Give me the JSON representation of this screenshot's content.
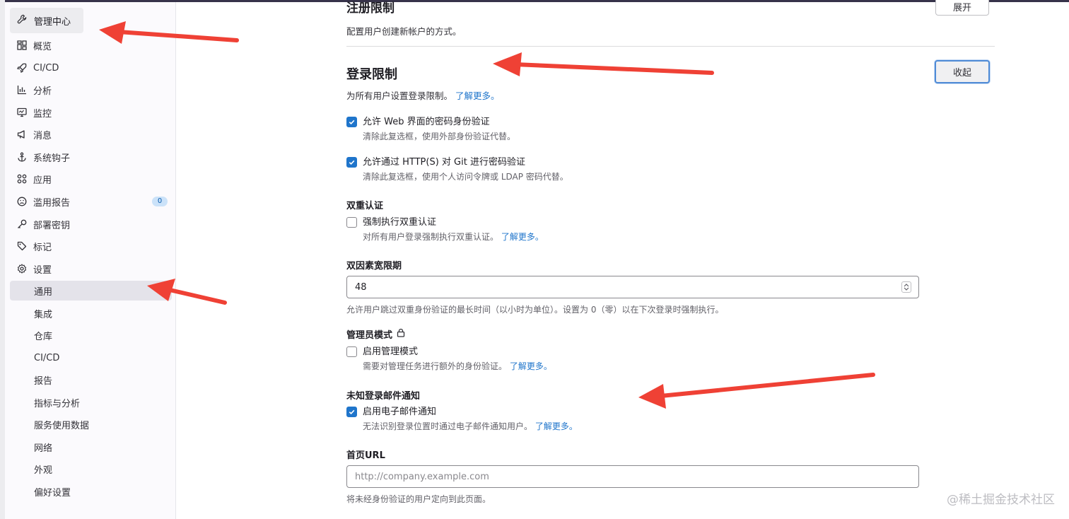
{
  "sidebar": {
    "header": "管理中心",
    "items": [
      {
        "label": "概览"
      },
      {
        "label": "CI/CD"
      },
      {
        "label": "分析"
      },
      {
        "label": "监控"
      },
      {
        "label": "消息"
      },
      {
        "label": "系统钩子"
      },
      {
        "label": "应用"
      },
      {
        "label": "滥用报告",
        "badge": "0"
      },
      {
        "label": "部署密钥"
      },
      {
        "label": "标记"
      },
      {
        "label": "设置"
      }
    ],
    "settings_sub": [
      {
        "label": "通用",
        "active": true
      },
      {
        "label": "集成"
      },
      {
        "label": "仓库"
      },
      {
        "label": "CI/CD"
      },
      {
        "label": "报告"
      },
      {
        "label": "指标与分析"
      },
      {
        "label": "服务使用数据"
      },
      {
        "label": "网络"
      },
      {
        "label": "外观"
      },
      {
        "label": "偏好设置"
      }
    ]
  },
  "signup": {
    "title": "注册限制",
    "description": "配置用户创建新帐户的方式。",
    "button": "展开"
  },
  "signin": {
    "title": "登录限制",
    "description": "为所有用户设置登录限制。",
    "learn_more": "了解更多。",
    "button": "收起",
    "web_password": {
      "label": "允许 Web 界面的密码身份验证",
      "help": "清除此复选框，使用外部身份验证代替。",
      "checked": true
    },
    "git_password": {
      "label": "允许通过 HTTP(S) 对 Git 进行密码验证",
      "help": "清除此复选框，使用个人访问令牌或 LDAP 密码代替。",
      "checked": true
    },
    "two_factor": {
      "group": "双重认证",
      "label": "强制执行双重认证",
      "help": "对所有用户登录强制执行双重认证。",
      "learn_more": "了解更多。",
      "checked": false
    },
    "grace_period": {
      "label": "双因素宽限期",
      "value": "48",
      "help": "允许用户跳过双重身份验证的最长时间（以小时为单位）。设置为 0（零）以在下次登录时强制执行。"
    },
    "admin_mode": {
      "group": "管理员模式",
      "label": "启用管理模式",
      "help": "需要对管理任务进行额外的身份验证。",
      "learn_more": "了解更多。",
      "checked": false
    },
    "unknown_signin": {
      "group": "未知登录邮件通知",
      "label": "启用电子邮件通知",
      "help": "无法识别登录位置时通过电子邮件通知用户。",
      "learn_more": "了解更多。",
      "checked": true
    },
    "home_url": {
      "label": "首页URL",
      "placeholder": "http://company.example.com",
      "help": "将未经身份验证的用户定向到此页面。"
    }
  },
  "watermark": "@稀土掘金技术社区",
  "colors": {
    "accent": "#1f75cb",
    "annotation_arrow": "#ef4135"
  }
}
